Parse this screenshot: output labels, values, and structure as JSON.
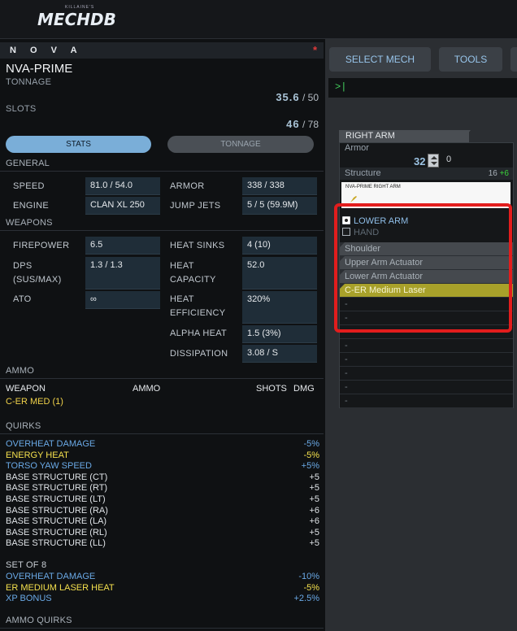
{
  "header": {
    "logo_tag": "KILLAINE'S",
    "logo_text": "MECHDB"
  },
  "mech": {
    "chassis": "N O V A",
    "variant": "NVA-PRIME",
    "tonnage_label": "TONNAGE",
    "tonnage_value": "35.6",
    "tonnage_max": "/ 50",
    "slots_label": "SLOTS",
    "slots_value": "46",
    "slots_max": "/ 78",
    "unsaved_marker": "*"
  },
  "toggle": {
    "stats": "STATS",
    "tonnage": "TONNAGE"
  },
  "general": {
    "title": "GENERAL",
    "speed_label": "SPEED",
    "speed_value": "81.0 / 54.0",
    "armor_label": "ARMOR",
    "armor_value": "338 / 338",
    "engine_label": "ENGINE",
    "engine_value": "CLAN XL 250",
    "jumpjets_label": "JUMP JETS",
    "jumpjets_value": "5 / 5 (59.9M)"
  },
  "weapons": {
    "title": "WEAPONS",
    "firepower_label": "FIREPOWER",
    "firepower_value": "6.5",
    "heatsinks_label": "HEAT SINKS",
    "heatsinks_value": "4 (10)",
    "dps_label_1": "DPS",
    "dps_label_2": "(SUS/MAX)",
    "dps_value": "1.3 / 1.3",
    "heatcap_label_1": "HEAT",
    "heatcap_label_2": "CAPACITY",
    "heatcap_value": "52.0",
    "ato_label": "ATO",
    "ato_value": "∞",
    "heateff_label_1": "HEAT",
    "heateff_label_2": "EFFICIENCY",
    "heateff_value": "320%",
    "alpha_label": "ALPHA HEAT",
    "alpha_value": "1.5 (3%)",
    "dissipation_label": "DISSIPATION",
    "dissipation_value": "3.08 / S"
  },
  "ammo": {
    "title": "AMMO",
    "col_weapon": "WEAPON",
    "col_ammo": "AMMO",
    "col_shots": "SHOTS",
    "col_dmg": "DMG",
    "items": [
      "C-ER MED (1)"
    ]
  },
  "quirks": {
    "title": "QUIRKS",
    "items": [
      {
        "name": "OVERHEAT DAMAGE",
        "value": "-5%",
        "color": "blue"
      },
      {
        "name": "ENERGY HEAT",
        "value": "-5%",
        "color": "yellow"
      },
      {
        "name": "TORSO YAW SPEED",
        "value": "+5%",
        "color": "blue"
      },
      {
        "name": "BASE STRUCTURE (CT)",
        "value": "+5",
        "color": "white"
      },
      {
        "name": "BASE STRUCTURE (RT)",
        "value": "+5",
        "color": "white"
      },
      {
        "name": "BASE STRUCTURE (LT)",
        "value": "+5",
        "color": "white"
      },
      {
        "name": "BASE STRUCTURE (RA)",
        "value": "+6",
        "color": "white"
      },
      {
        "name": "BASE STRUCTURE (LA)",
        "value": "+6",
        "color": "white"
      },
      {
        "name": "BASE STRUCTURE (RL)",
        "value": "+5",
        "color": "white"
      },
      {
        "name": "BASE STRUCTURE (LL)",
        "value": "+5",
        "color": "white"
      }
    ],
    "set_title": "SET OF 8",
    "set_items": [
      {
        "name": "OVERHEAT DAMAGE",
        "value": "-10%",
        "color": "blue"
      },
      {
        "name": "ER MEDIUM LASER HEAT",
        "value": "-5%",
        "color": "yellow"
      },
      {
        "name": "XP BONUS",
        "value": "+2.5%",
        "color": "blue"
      }
    ],
    "ammo_quirks_title": "AMMO QUIRKS"
  },
  "tabs": {
    "select_mech": "SELECT MECH",
    "tools": "TOOLS"
  },
  "console": {
    "prompt": ">|"
  },
  "right_arm": {
    "title": "RIGHT ARM",
    "armor_label": "Armor",
    "armor_value": "32",
    "armor_rear": "0",
    "structure_label": "Structure",
    "structure_value": "16",
    "structure_bonus": "+6",
    "image_caption": "NVA-PRIME RIGHT ARM",
    "lower_arm_label": "LOWER ARM",
    "hand_label": "HAND",
    "slots": [
      {
        "label": "Shoulder",
        "kind": "fixed"
      },
      {
        "label": "Upper Arm Actuator",
        "kind": "fixed"
      },
      {
        "label": "Lower Arm Actuator",
        "kind": "fixed"
      },
      {
        "label": "C-ER Medium Laser",
        "kind": "weapon"
      },
      {
        "label": "-",
        "kind": "empty"
      },
      {
        "label": "-",
        "kind": "empty"
      },
      {
        "label": "-",
        "kind": "empty"
      },
      {
        "label": "-",
        "kind": "empty"
      },
      {
        "label": "-",
        "kind": "empty"
      },
      {
        "label": "-",
        "kind": "empty"
      },
      {
        "label": "-",
        "kind": "empty"
      },
      {
        "label": "-",
        "kind": "empty"
      }
    ]
  },
  "colors": {
    "accent_blue": "#7aaed8",
    "highlight_red": "#e21d1d",
    "weapon_slot": "#a8a12a",
    "structure_bonus": "#3ad13a"
  }
}
